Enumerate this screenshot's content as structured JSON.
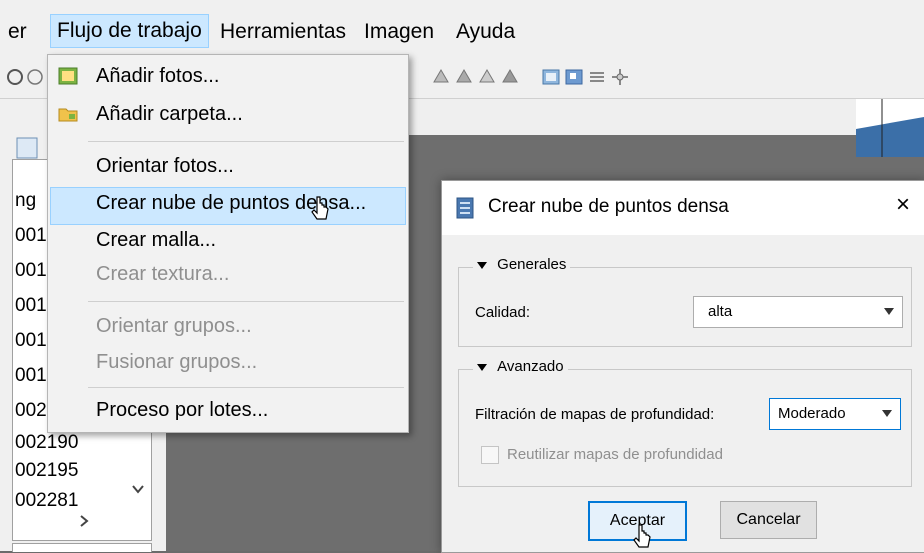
{
  "menubar": {
    "items": [
      "er",
      "Flujo de trabajo",
      "Herramientas",
      "Imagen",
      "Ayuda"
    ]
  },
  "workflow_menu": {
    "items": [
      {
        "label": "Añadir fotos...",
        "icon": "add-photos-icon",
        "enabled": true
      },
      {
        "label": "Añadir carpeta...",
        "icon": "add-folder-icon",
        "enabled": true
      },
      {
        "label": "Orientar fotos...",
        "enabled": true
      },
      {
        "label": "Crear nube de puntos densa...",
        "enabled": true,
        "highlighted": true
      },
      {
        "label": "Crear malla...",
        "enabled": true
      },
      {
        "label": "Crear textura...",
        "enabled": false
      },
      {
        "label": "Orientar grupos...",
        "enabled": false
      },
      {
        "label": "Fusionar grupos...",
        "enabled": false
      },
      {
        "label": "Proceso por lotes...",
        "enabled": true
      }
    ]
  },
  "left_pane": {
    "items": [
      "ng",
      "001",
      "001",
      "001",
      "001",
      "001",
      "002",
      "002190",
      "002195",
      "002281"
    ]
  },
  "dialog": {
    "title": "Crear nube de puntos densa",
    "close": "×",
    "general": {
      "legend": "Generales",
      "quality_label": "Calidad:",
      "quality_value": "alta"
    },
    "advanced": {
      "legend": "Avanzado",
      "depth_filter_label": "Filtración de mapas de profundidad:",
      "depth_filter_value": "Moderado",
      "reuse_label": "Reutilizar mapas de profundidad"
    },
    "ok_label": "Aceptar",
    "cancel_label": "Cancelar"
  },
  "colors": {
    "highlight": "#cce8ff",
    "highlight_border": "#99d1ff",
    "workspace": "#6e6e6e"
  }
}
